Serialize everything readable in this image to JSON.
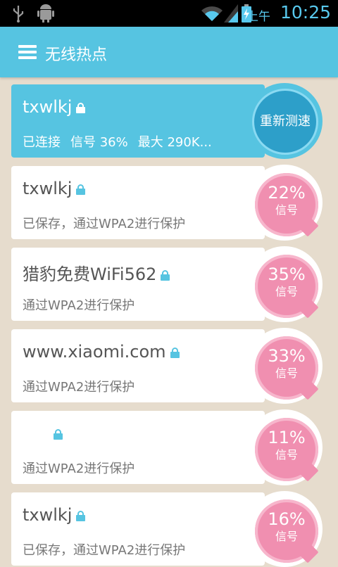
{
  "status_bar": {
    "ampm": "上午",
    "time": "10:25",
    "icons": [
      "usb-icon",
      "android-debug-icon",
      "wifi-icon",
      "signal-icon",
      "battery-charging-icon"
    ]
  },
  "header": {
    "title": "无线热点",
    "menu_icon": "menu-icon"
  },
  "networks": [
    {
      "ssid": "txwlkj",
      "locked": true,
      "status": "已连接",
      "signal_label": "信号 36%",
      "max_speed": "最大 290K...",
      "action": "重新测速",
      "connected": true
    },
    {
      "ssid": "txwlkj",
      "locked": true,
      "detail": "已保存，通过WPA2进行保护",
      "percent": "22%",
      "signal_label": "信号"
    },
    {
      "ssid": "猎豹免费WiFi562",
      "locked": true,
      "detail": "通过WPA2进行保护",
      "percent": "35%",
      "signal_label": "信号"
    },
    {
      "ssid": "www.xiaomi.com",
      "locked": true,
      "detail": "通过WPA2进行保护",
      "percent": "33%",
      "signal_label": "信号"
    },
    {
      "ssid": "",
      "locked": true,
      "detail": "通过WPA2进行保护",
      "percent": "11%",
      "signal_label": "信号"
    },
    {
      "ssid": "txwlkj",
      "locked": true,
      "detail": "已保存，通过WPA2进行保护",
      "percent": "16%",
      "signal_label": "信号"
    }
  ],
  "colors": {
    "accent": "#56c4e1",
    "signal_pink": "#f08fb0",
    "background": "#e6dccd"
  }
}
